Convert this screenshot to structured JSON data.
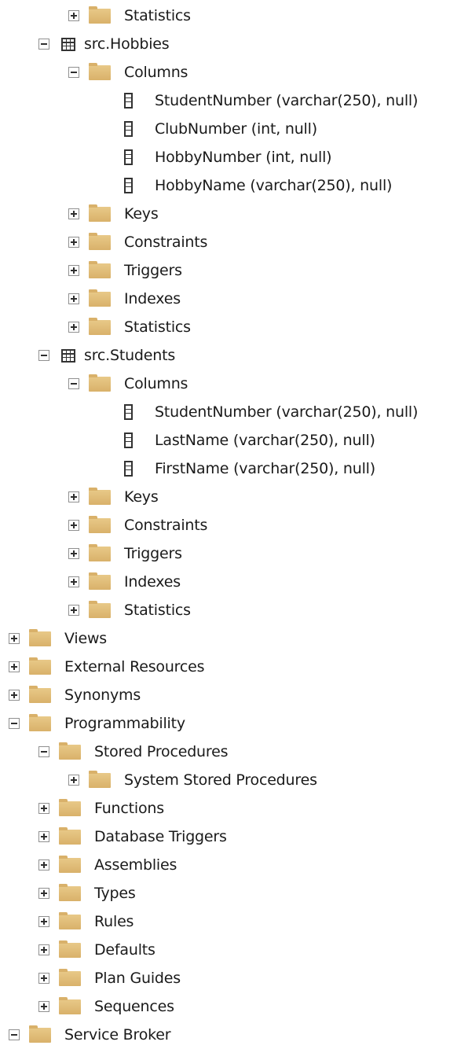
{
  "tree": {
    "rows": [
      {
        "label": "Statistics",
        "icon": "folder-icon",
        "expander": "plus"
      },
      {
        "label": "src.Hobbies",
        "icon": "table-icon",
        "expander": "minus"
      },
      {
        "label": "Columns",
        "icon": "folder-icon",
        "expander": "minus"
      },
      {
        "label": "StudentNumber (varchar(250), null)",
        "icon": "column-icon",
        "expander": "none"
      },
      {
        "label": "ClubNumber (int, null)",
        "icon": "column-icon",
        "expander": "none"
      },
      {
        "label": "HobbyNumber (int, null)",
        "icon": "column-icon",
        "expander": "none"
      },
      {
        "label": "HobbyName (varchar(250), null)",
        "icon": "column-icon",
        "expander": "none"
      },
      {
        "label": "Keys",
        "icon": "folder-icon",
        "expander": "plus"
      },
      {
        "label": "Constraints",
        "icon": "folder-icon",
        "expander": "plus"
      },
      {
        "label": "Triggers",
        "icon": "folder-icon",
        "expander": "plus"
      },
      {
        "label": "Indexes",
        "icon": "folder-icon",
        "expander": "plus"
      },
      {
        "label": "Statistics",
        "icon": "folder-icon",
        "expander": "plus"
      },
      {
        "label": "src.Students",
        "icon": "table-icon",
        "expander": "minus"
      },
      {
        "label": "Columns",
        "icon": "folder-icon",
        "expander": "minus"
      },
      {
        "label": "StudentNumber (varchar(250), null)",
        "icon": "column-icon",
        "expander": "none"
      },
      {
        "label": "LastName (varchar(250), null)",
        "icon": "column-icon",
        "expander": "none"
      },
      {
        "label": "FirstName (varchar(250), null)",
        "icon": "column-icon",
        "expander": "none"
      },
      {
        "label": "Keys",
        "icon": "folder-icon",
        "expander": "plus"
      },
      {
        "label": "Constraints",
        "icon": "folder-icon",
        "expander": "plus"
      },
      {
        "label": "Triggers",
        "icon": "folder-icon",
        "expander": "plus"
      },
      {
        "label": "Indexes",
        "icon": "folder-icon",
        "expander": "plus"
      },
      {
        "label": "Statistics",
        "icon": "folder-icon",
        "expander": "plus"
      },
      {
        "label": "Views",
        "icon": "folder-icon",
        "expander": "plus"
      },
      {
        "label": "External Resources",
        "icon": "folder-icon",
        "expander": "plus"
      },
      {
        "label": "Synonyms",
        "icon": "folder-icon",
        "expander": "plus"
      },
      {
        "label": "Programmability",
        "icon": "folder-icon",
        "expander": "minus"
      },
      {
        "label": "Stored Procedures",
        "icon": "folder-icon",
        "expander": "minus"
      },
      {
        "label": "System Stored Procedures",
        "icon": "folder-icon",
        "expander": "plus"
      },
      {
        "label": "Functions",
        "icon": "folder-icon",
        "expander": "plus"
      },
      {
        "label": "Database Triggers",
        "icon": "folder-icon",
        "expander": "plus"
      },
      {
        "label": "Assemblies",
        "icon": "folder-icon",
        "expander": "plus"
      },
      {
        "label": "Types",
        "icon": "folder-icon",
        "expander": "plus"
      },
      {
        "label": "Rules",
        "icon": "folder-icon",
        "expander": "plus"
      },
      {
        "label": "Defaults",
        "icon": "folder-icon",
        "expander": "plus"
      },
      {
        "label": "Plan Guides",
        "icon": "folder-icon",
        "expander": "plus"
      },
      {
        "label": "Sequences",
        "icon": "folder-icon",
        "expander": "plus"
      },
      {
        "label": "Service Broker",
        "icon": "folder-icon",
        "expander": "minus"
      }
    ]
  }
}
